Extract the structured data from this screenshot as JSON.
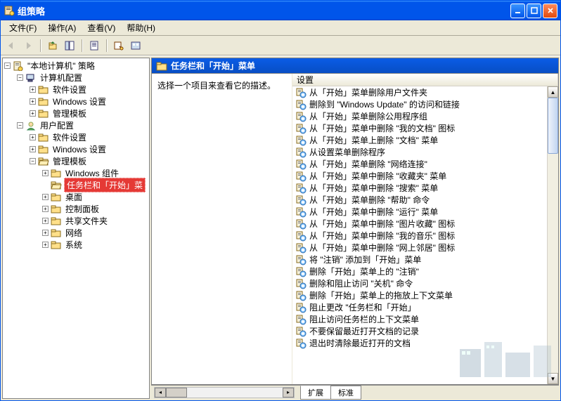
{
  "window": {
    "title": "组策略"
  },
  "menu": {
    "file": "文件(F)",
    "action": "操作(A)",
    "view": "查看(V)",
    "help": "帮助(H)"
  },
  "tree": {
    "root": "\"本地计算机\" 策略",
    "computer": "计算机配置",
    "computer_children": [
      "软件设置",
      "Windows 设置",
      "管理模板"
    ],
    "user": "用户配置",
    "user_software": "软件设置",
    "user_windows": "Windows 设置",
    "user_admin": "管理模板",
    "admin_children_top": [
      "Windows 组件"
    ],
    "selected": "任务栏和「开始」菜",
    "admin_children_bottom": [
      "桌面",
      "控制面板",
      "共享文件夹",
      "网络",
      "系统"
    ]
  },
  "detail": {
    "header": "任务栏和「开始」菜单",
    "prompt": "选择一个项目来查看它的描述。",
    "column": "设置",
    "items": [
      "从「开始」菜单删除用户文件夹",
      "删除到 \"Windows Update\" 的访问和链接",
      "从「开始」菜单删除公用程序组",
      "从「开始」菜单中删除 \"我的文档\" 图标",
      "从「开始」菜单上删除 \"文档\" 菜单",
      "从设置菜单删除程序",
      "从「开始」菜单删除 \"网络连接\"",
      "从「开始」菜单中删除 \"收藏夹\" 菜单",
      "从「开始」菜单中删除 \"搜索\" 菜单",
      "从「开始」菜单删除 \"帮助\" 命令",
      "从「开始」菜单中删除 \"运行\" 菜单",
      "从「开始」菜单中删除 \"图片收藏\" 图标",
      "从「开始」菜单中删除 \"我的音乐\" 图标",
      "从「开始」菜单中删除 \"网上邻居\" 图标",
      "将 \"注销\" 添加到「开始」菜单",
      "删除「开始」菜单上的 \"注销\"",
      "删除和阻止访问 \"关机\" 命令",
      "删除「开始」菜单上的拖放上下文菜单",
      "阻止更改 \"任务栏和「开始」",
      "阻止访问任务栏的上下文菜单",
      "不要保留最近打开文档的记录",
      "退出时清除最近打开的文档"
    ]
  },
  "tabs": {
    "ext": "扩展",
    "std": "标准"
  }
}
